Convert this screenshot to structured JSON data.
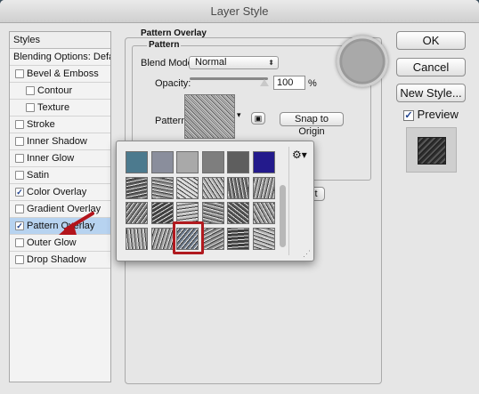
{
  "window": {
    "title": "Layer Style"
  },
  "styles_list": {
    "header": "Styles",
    "blending_options": "Blending Options: Default",
    "items": [
      {
        "label": "Bevel & Emboss",
        "checked": false,
        "indent": false,
        "selected": false
      },
      {
        "label": "Contour",
        "checked": false,
        "indent": true,
        "selected": false
      },
      {
        "label": "Texture",
        "checked": false,
        "indent": true,
        "selected": false
      },
      {
        "label": "Stroke",
        "checked": false,
        "indent": false,
        "selected": false
      },
      {
        "label": "Inner Shadow",
        "checked": false,
        "indent": false,
        "selected": false
      },
      {
        "label": "Inner Glow",
        "checked": false,
        "indent": false,
        "selected": false
      },
      {
        "label": "Satin",
        "checked": false,
        "indent": false,
        "selected": false
      },
      {
        "label": "Color Overlay",
        "checked": true,
        "indent": false,
        "selected": false
      },
      {
        "label": "Gradient Overlay",
        "checked": false,
        "indent": false,
        "selected": false
      },
      {
        "label": "Pattern Overlay",
        "checked": true,
        "indent": false,
        "selected": true
      },
      {
        "label": "Outer Glow",
        "checked": false,
        "indent": false,
        "selected": false
      },
      {
        "label": "Drop Shadow",
        "checked": false,
        "indent": false,
        "selected": false
      }
    ]
  },
  "pattern_overlay": {
    "section_title": "Pattern Overlay",
    "group_title": "Pattern",
    "blend_mode_label": "Blend Mode:",
    "blend_mode_value": "Normal",
    "opacity_label": "Opacity:",
    "opacity_value": "100",
    "opacity_unit": "%",
    "pattern_label": "Pattern:",
    "snap_button": "Snap to Origin",
    "hidden_button_tail": "t"
  },
  "buttons": {
    "ok": "OK",
    "cancel": "Cancel",
    "new_style": "New Style...",
    "preview_label": "Preview",
    "preview_checked": true
  },
  "pattern_picker": {
    "gear_symbol": "⚙▾",
    "tiles": [
      {
        "color": "#4c7a8e"
      },
      {
        "color": "#8a8e9c"
      },
      {
        "color": "#a9a9a9"
      },
      {
        "color": "#7e7e7e"
      },
      {
        "color": "#5e5e5e"
      },
      {
        "color": "#231a8c"
      },
      {
        "color": "#5a5a5a"
      },
      {
        "color": "#8c8c8c"
      },
      {
        "color": "#d8d8d8"
      },
      {
        "color": "#b5b5b5"
      },
      {
        "color": "#6e6e6e"
      },
      {
        "color": "#9a9a9a"
      },
      {
        "color": "#7a7a7a"
      },
      {
        "color": "#444444"
      },
      {
        "color": "#c0c0c0"
      },
      {
        "color": "#8c8c8c"
      },
      {
        "color": "#555555"
      },
      {
        "color": "#999999"
      },
      {
        "color": "#a3a3a3"
      },
      {
        "color": "#9b9b9b"
      },
      {
        "color": "#6e7c8e"
      },
      {
        "color": "#8f8f8f"
      },
      {
        "color": "#3f3f3f"
      },
      {
        "color": "#b9b9b9"
      }
    ],
    "selected_index": 20,
    "selection_color": "#b11a1f"
  },
  "annotation": {
    "arrow_color": "#b3141c"
  }
}
